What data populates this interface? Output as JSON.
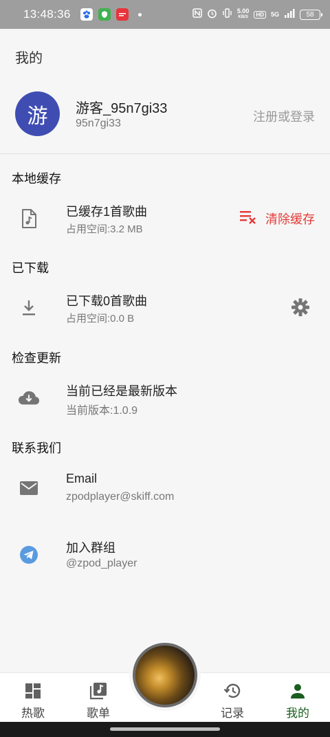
{
  "status_bar": {
    "time": "13:48:36",
    "net_speed_value": "5.00",
    "net_speed_unit": "KB/S",
    "hd_badge": "HD",
    "signal_label": "5G",
    "battery": "58"
  },
  "header": {
    "title": "我的"
  },
  "profile": {
    "avatar_char": "游",
    "username": "游客_95n7gi33",
    "user_id": "95n7gi33",
    "login_link": "注册或登录"
  },
  "sections": {
    "cache": {
      "title": "本地缓存",
      "item_title": "已缓存1首歌曲",
      "item_sub": "占用空间:3.2 MB",
      "action_label": "清除缓存",
      "action_color": "#e53935"
    },
    "downloads": {
      "title": "已下载",
      "item_title": "已下载0首歌曲",
      "item_sub": "占用空间:0.0 B"
    },
    "update": {
      "title": "检查更新",
      "item_title": "当前已经是最新版本",
      "item_sub": "当前版本:1.0.9"
    },
    "contact": {
      "title": "联系我们",
      "email_title": "Email",
      "email_value": "zpodplayer@skiff.com",
      "group_title": "加入群组",
      "group_value": "@zpod_player"
    }
  },
  "bottom_nav": {
    "items": [
      {
        "label": "热歌",
        "icon": "dashboard-icon"
      },
      {
        "label": "歌单",
        "icon": "music-library-icon"
      },
      {
        "label": "记录",
        "icon": "history-icon"
      },
      {
        "label": "我的",
        "icon": "person-icon"
      }
    ],
    "active_index": 3,
    "active_color": "#1b5e20"
  },
  "colors": {
    "avatar_bg": "#3f4db3",
    "telegram": "#5a9be0",
    "icon_gray": "#757575"
  }
}
